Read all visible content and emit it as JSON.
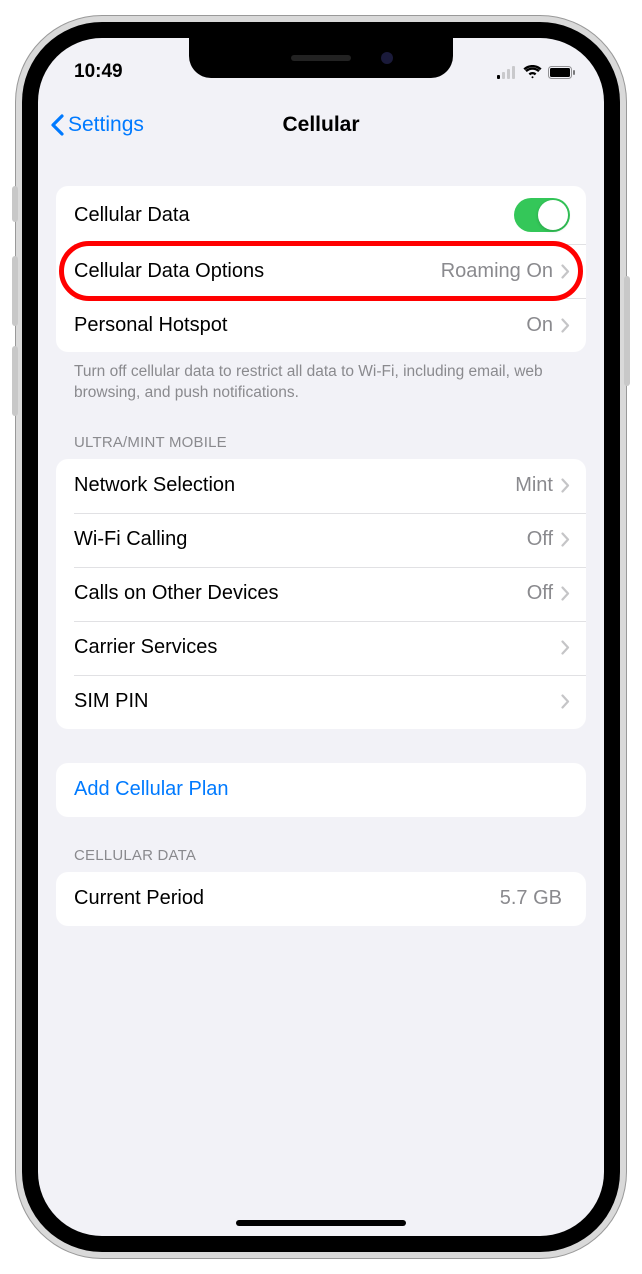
{
  "status": {
    "time": "10:49"
  },
  "nav": {
    "back_label": "Settings",
    "title": "Cellular"
  },
  "group1": {
    "cellular_data": {
      "label": "Cellular Data",
      "on": true
    },
    "data_options": {
      "label": "Cellular Data Options",
      "value": "Roaming On"
    },
    "hotspot": {
      "label": "Personal Hotspot",
      "value": "On"
    },
    "footer": "Turn off cellular data to restrict all data to Wi-Fi, including email, web browsing, and push notifications."
  },
  "carrier_header": "ULTRA/MINT MOBILE",
  "group2": {
    "network_selection": {
      "label": "Network Selection",
      "value": "Mint"
    },
    "wifi_calling": {
      "label": "Wi-Fi Calling",
      "value": "Off"
    },
    "other_devices": {
      "label": "Calls on Other Devices",
      "value": "Off"
    },
    "carrier_services": {
      "label": "Carrier Services",
      "value": ""
    },
    "sim_pin": {
      "label": "SIM PIN",
      "value": ""
    }
  },
  "group3": {
    "add_plan": "Add Cellular Plan"
  },
  "usage_header": "CELLULAR DATA",
  "group4": {
    "current_period": {
      "label": "Current Period",
      "value": "5.7 GB"
    }
  }
}
